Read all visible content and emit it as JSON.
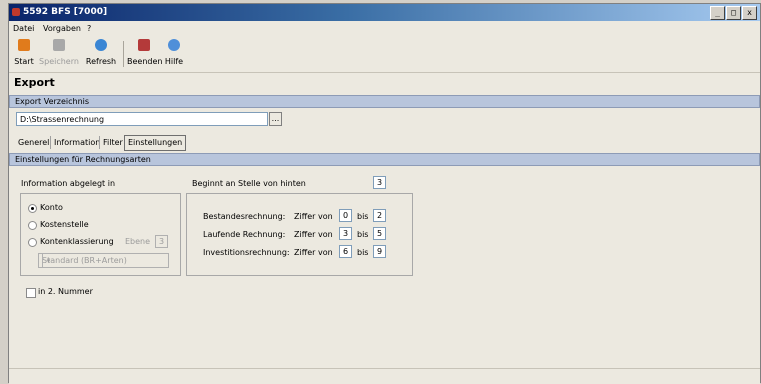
{
  "window": {
    "title": "5592 BFS [7000]",
    "min_label": "_",
    "max_label": "□",
    "close_label": "x"
  },
  "menu": {
    "datei": "Datei",
    "vorgaben": "Vorgaben",
    "help": "?"
  },
  "toolbar": {
    "start": "Start",
    "speichern": "Speichern",
    "refresh": "Refresh",
    "beenden": "Beenden",
    "hilfe": "Hilfe"
  },
  "page_title": "Export",
  "export_dir": {
    "section_label": "Export Verzeichnis",
    "path": "D:\\Strassenrechnung",
    "browse_label": "..."
  },
  "tabs": [
    "Generell",
    "Information",
    "Filter",
    "Einstellungen"
  ],
  "settings": {
    "section_label": "Einstellungen für Rechnungsarten",
    "info_label": "Information abgelegt in",
    "options": {
      "konto": "Konto",
      "kostenstelle": "Kostenstelle",
      "kontenklassierung": "Kontenklassierung"
    },
    "ebene_label": "Ebene",
    "ebene_value": "3",
    "standard_select": "Standard (BR+Arten)",
    "select_arrow": "▾",
    "second_number_label": "in 2. Nummer",
    "beginnt_label": "Beginnt an Stelle von hinten",
    "beginnt_value": "3",
    "ziffer_label": "Ziffer von",
    "bis_label": "bis",
    "rows": [
      {
        "label": "Bestandesrechnung:",
        "from": "0",
        "to": "2"
      },
      {
        "label": "Laufende Rechnung:",
        "from": "3",
        "to": "5"
      },
      {
        "label": "Investitionsrechnung:",
        "from": "6",
        "to": "9"
      }
    ]
  },
  "colors": {
    "title_start": "#0a246a",
    "section_bar": "#b8c5dc"
  }
}
